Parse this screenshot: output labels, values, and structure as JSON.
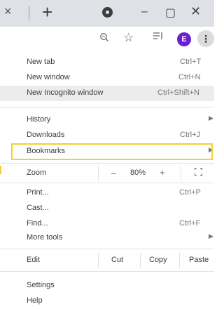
{
  "tabstrip": {
    "tab_close": "×",
    "new_tab": "+",
    "window_minimize": "–",
    "window_maximize": "▢",
    "window_close": "✕"
  },
  "toolbar": {
    "avatar_letter": "E",
    "menu_button": "⋮",
    "avatar_color": "#6a1fd1"
  },
  "menu": {
    "new_tab": {
      "label": "New tab",
      "shortcut": "Ctrl+T"
    },
    "new_window": {
      "label": "New window",
      "shortcut": "Ctrl+N"
    },
    "new_incognito": {
      "label": "New Incognito window",
      "shortcut": "Ctrl+Shift+N"
    },
    "history": {
      "label": "History"
    },
    "downloads": {
      "label": "Downloads",
      "shortcut": "Ctrl+J"
    },
    "bookmarks": {
      "label": "Bookmarks"
    },
    "zoom": {
      "label": "Zoom",
      "minus": "–",
      "value": "80%",
      "plus": "+"
    },
    "print": {
      "label": "Print...",
      "shortcut": "Ctrl+P"
    },
    "cast": {
      "label": "Cast..."
    },
    "find": {
      "label": "Find...",
      "shortcut": "Ctrl+F"
    },
    "more_tools": {
      "label": "More tools"
    },
    "edit": {
      "label": "Edit",
      "cut": "Cut",
      "copy": "Copy",
      "paste": "Paste"
    },
    "settings": {
      "label": "Settings"
    },
    "help": {
      "label": "Help"
    }
  },
  "highlight_color": "#f2d12e"
}
